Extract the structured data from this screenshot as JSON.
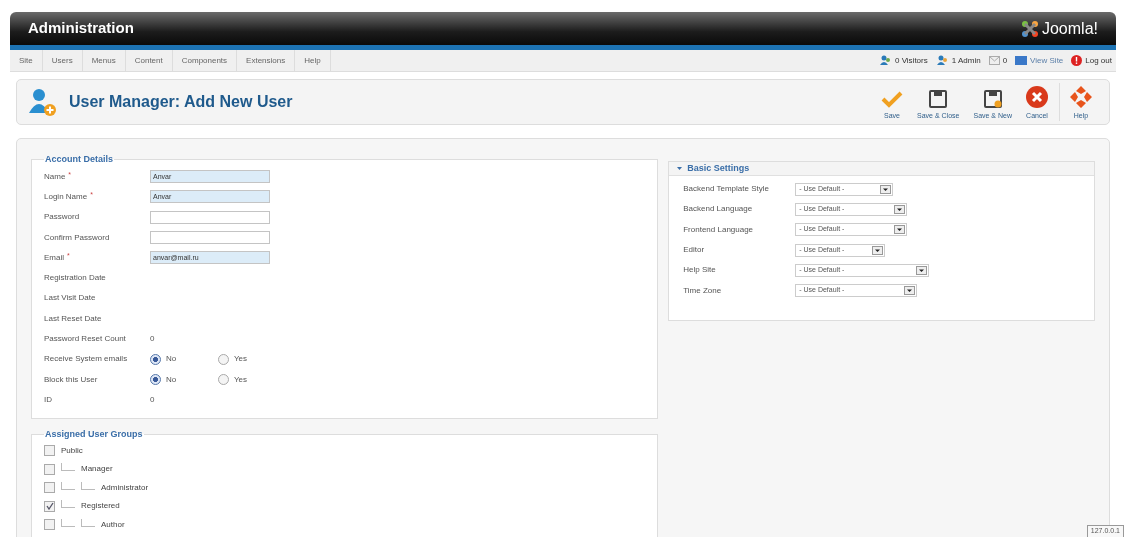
{
  "header": {
    "title": "Administration",
    "logo_text": "Joomla!"
  },
  "menu": [
    "Site",
    "Users",
    "Menus",
    "Content",
    "Components",
    "Extensions",
    "Help"
  ],
  "status": [
    {
      "kind": "visitors",
      "text": "0 Visitors"
    },
    {
      "kind": "admin",
      "text": "1 Admin"
    },
    {
      "kind": "messages",
      "text": "0"
    },
    {
      "kind": "viewsite",
      "text": "View Site"
    },
    {
      "kind": "logout",
      "text": "Log out"
    }
  ],
  "page_title": "User Manager: Add New User",
  "toolbar": [
    {
      "kind": "save",
      "label": "Save"
    },
    {
      "kind": "save_close",
      "label": "Save & Close"
    },
    {
      "kind": "save_new",
      "label": "Save & New"
    },
    {
      "kind": "cancel",
      "label": "Cancel"
    },
    {
      "kind": "help",
      "label": "Help"
    }
  ],
  "account_details": {
    "legend": "Account Details",
    "fields": [
      {
        "kind": "input",
        "label": "Name",
        "required_mark": "*",
        "value": "Anvar",
        "highlighted": true
      },
      {
        "kind": "input",
        "label": "Login Name",
        "required_mark": "*",
        "value": "Anvar",
        "highlighted": true
      },
      {
        "kind": "input",
        "label": "Password",
        "highlighted": false
      },
      {
        "kind": "input",
        "label": "Confirm Password",
        "highlighted": false
      },
      {
        "kind": "input",
        "label": "Email",
        "required_mark": "*",
        "value": "anvar@mail.ru",
        "highlighted": true
      },
      {
        "kind": "text",
        "label": "Registration Date"
      },
      {
        "kind": "text",
        "label": "Last Visit Date"
      },
      {
        "kind": "text",
        "label": "Last Reset Date"
      },
      {
        "kind": "text",
        "label": "Password Reset Count",
        "value": "0"
      },
      {
        "kind": "radio",
        "label": "Receive System emails",
        "options": [
          {
            "label": "No",
            "selected": true
          },
          {
            "label": "Yes",
            "selected": false
          }
        ]
      },
      {
        "kind": "radio",
        "label": "Block this User",
        "options": [
          {
            "label": "No",
            "selected": true
          },
          {
            "label": "Yes",
            "selected": false
          }
        ]
      },
      {
        "kind": "text",
        "label": "ID",
        "value": "0"
      }
    ]
  },
  "user_groups": {
    "legend": "Assigned User Groups",
    "groups": [
      {
        "label": "Public",
        "checked": false,
        "children": [
          {
            "label": "Manager",
            "checked": false,
            "children": [
              {
                "label": "Administrator",
                "checked": false
              }
            ]
          },
          {
            "label": "Registered",
            "checked": true,
            "children": [
              {
                "label": "Author",
                "checked": false
              }
            ]
          }
        ]
      }
    ]
  },
  "basic_settings": {
    "title": "Basic Settings",
    "expanded": true,
    "fields": [
      {
        "label": "Backend Template Style",
        "value": "- Use Default -"
      },
      {
        "label": "Backend Language",
        "value": "- Use Default -"
      },
      {
        "label": "Frontend Language",
        "value": "- Use Default -"
      },
      {
        "label": "Editor",
        "value": "- Use Default -"
      },
      {
        "label": "Help Site",
        "value": "- Use Default -"
      },
      {
        "label": "Time Zone",
        "value": "- Use Default -"
      }
    ]
  },
  "footer_badge": "127.0.0.1"
}
